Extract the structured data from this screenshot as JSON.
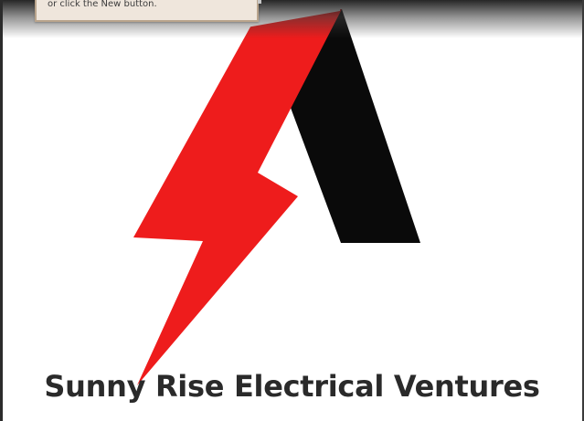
{
  "tooltip": {
    "text": "or click the New button."
  },
  "logo": {
    "company_name": "Sunny Rise Electrical Ventures",
    "bolt_color": "#ee1c1c",
    "arm_color": "#0a0a0a",
    "text_color": "#2a2a2a"
  }
}
